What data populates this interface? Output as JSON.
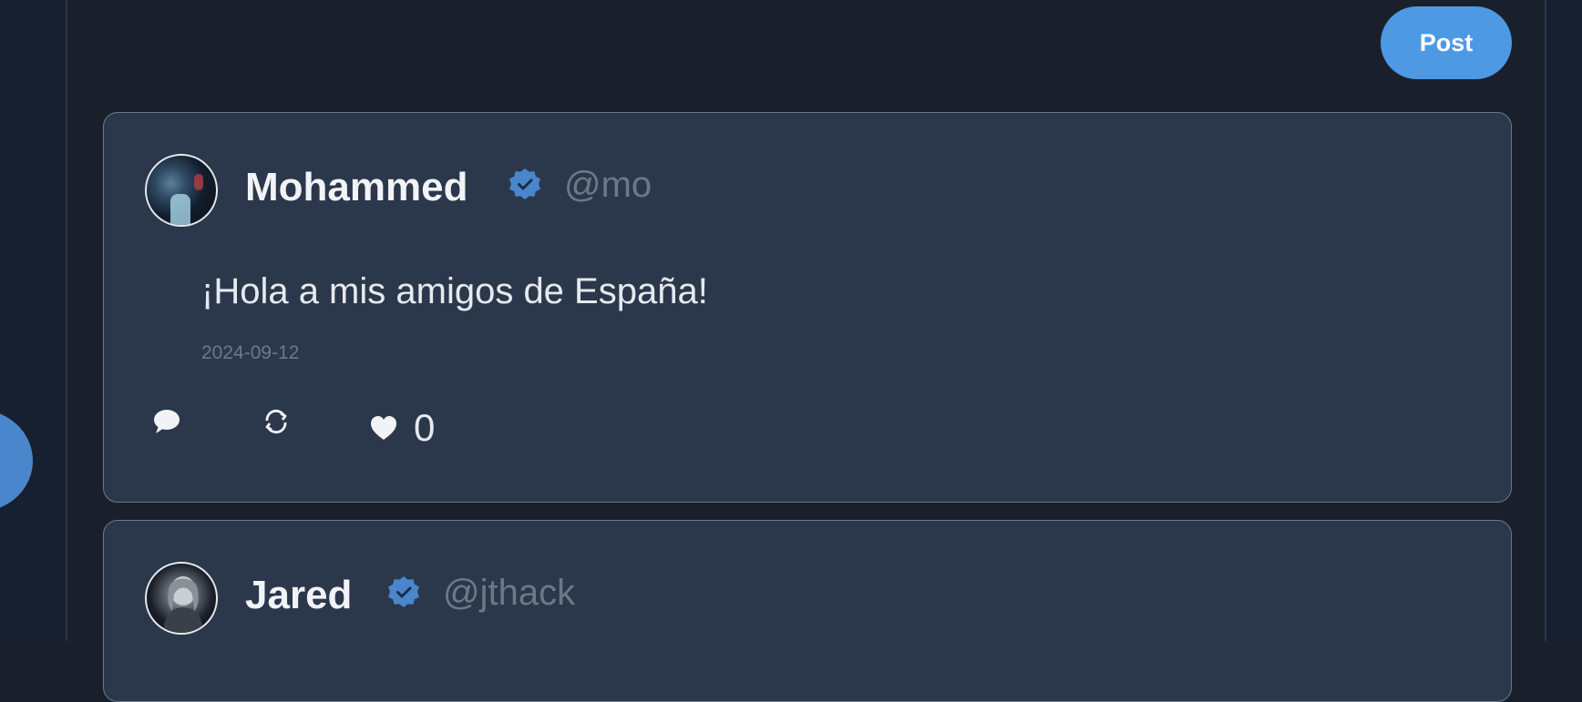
{
  "toolbar": {
    "post_label": "Post"
  },
  "posts": [
    {
      "author": "Mohammed",
      "handle": "@mo",
      "verified": true,
      "text": "¡Hola a mis amigos de España!",
      "date": "2024-09-12",
      "likes": "0",
      "avatar_icon": "user-avatar"
    },
    {
      "author": "Jared",
      "handle": "@jthack",
      "verified": true,
      "avatar_icon": "user-avatar"
    }
  ],
  "colors": {
    "background": "#19202c",
    "card": "#2b384b",
    "accent": "#4e99e4",
    "badge": "#4a86cc",
    "muted": "#6d7887"
  },
  "icons": {
    "reply": "comment-icon",
    "repost": "repost-icon",
    "like": "heart-icon",
    "verified": "verified-badge-icon"
  }
}
